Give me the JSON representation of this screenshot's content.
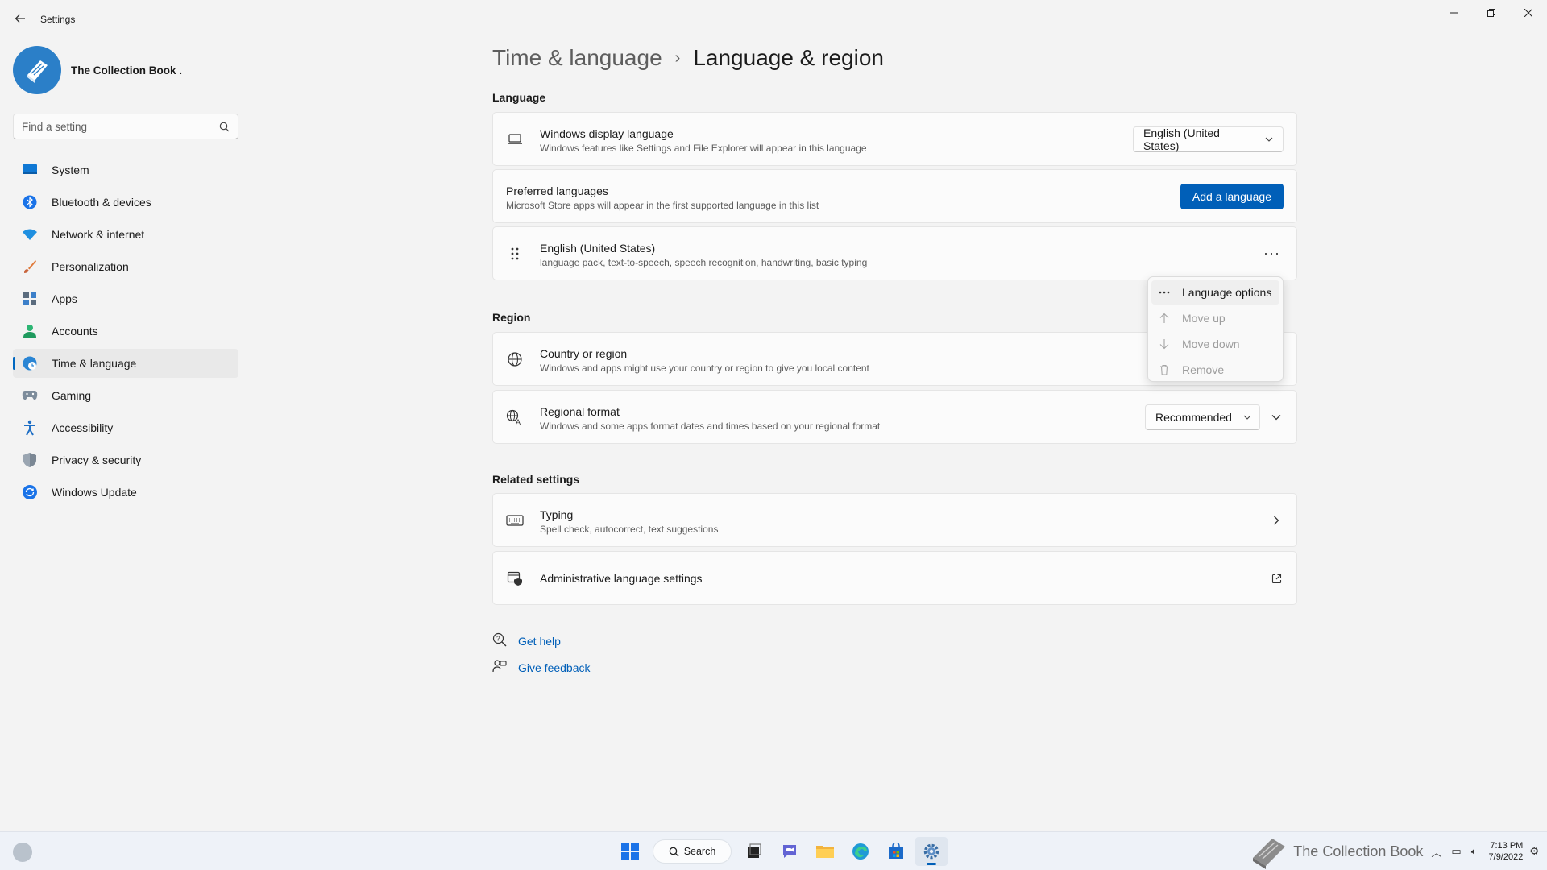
{
  "window": {
    "app_title": "Settings",
    "minimize_icon": "minimize-icon",
    "maximize_icon": "restore-icon",
    "close_icon": "close-icon"
  },
  "profile": {
    "name": "The Collection Book ."
  },
  "search": {
    "placeholder": "Find a setting",
    "value": ""
  },
  "sidebar": {
    "items": [
      {
        "label": "System",
        "icon": "monitor-icon",
        "active": false
      },
      {
        "label": "Bluetooth & devices",
        "icon": "bluetooth-icon",
        "active": false
      },
      {
        "label": "Network & internet",
        "icon": "wifi-icon",
        "active": false
      },
      {
        "label": "Personalization",
        "icon": "brush-icon",
        "active": false
      },
      {
        "label": "Apps",
        "icon": "apps-icon",
        "active": false
      },
      {
        "label": "Accounts",
        "icon": "person-icon",
        "active": false
      },
      {
        "label": "Time & language",
        "icon": "globe-clock-icon",
        "active": true
      },
      {
        "label": "Gaming",
        "icon": "gamepad-icon",
        "active": false
      },
      {
        "label": "Accessibility",
        "icon": "accessibility-icon",
        "active": false
      },
      {
        "label": "Privacy & security",
        "icon": "shield-icon",
        "active": false
      },
      {
        "label": "Windows Update",
        "icon": "update-icon",
        "active": false
      }
    ]
  },
  "breadcrumb": {
    "parent": "Time & language",
    "separator": "›",
    "current": "Language & region"
  },
  "language_section": {
    "title": "Language",
    "display_language": {
      "title": "Windows display language",
      "subtitle": "Windows features like Settings and File Explorer will appear in this language",
      "selected": "English (United States)"
    },
    "preferred": {
      "title": "Preferred languages",
      "subtitle": "Microsoft Store apps will appear in the first supported language in this list",
      "button": "Add a language"
    },
    "language_item": {
      "title": "English (United States)",
      "subtitle": "language pack, text-to-speech, speech recognition, handwriting, basic typing",
      "more": "···"
    }
  },
  "context_menu": {
    "items": [
      {
        "label": "Language options",
        "icon": "more-icon",
        "enabled": true
      },
      {
        "label": "Move up",
        "icon": "arrow-up-icon",
        "enabled": false
      },
      {
        "label": "Move down",
        "icon": "arrow-down-icon",
        "enabled": false
      },
      {
        "label": "Remove",
        "icon": "trash-icon",
        "enabled": false
      }
    ]
  },
  "region_section": {
    "title": "Region",
    "country": {
      "title": "Country or region",
      "subtitle": "Windows and apps might use your country or region to give you local content"
    },
    "format": {
      "title": "Regional format",
      "subtitle": "Windows and some apps format dates and times based on your regional format",
      "selected": "Recommended"
    }
  },
  "related_section": {
    "title": "Related settings",
    "typing": {
      "title": "Typing",
      "subtitle": "Spell check, autocorrect, text suggestions"
    },
    "admin": {
      "title": "Administrative language settings"
    }
  },
  "help_links": {
    "get_help": "Get help",
    "give_feedback": "Give feedback"
  },
  "taskbar": {
    "search_label": "Search",
    "watermark": "The Collection Book",
    "time": "7:13 PM",
    "date": "7/9/2022"
  },
  "colors": {
    "accent": "#005fb8",
    "background": "#f3f3f3",
    "card": "#fbfbfb"
  }
}
